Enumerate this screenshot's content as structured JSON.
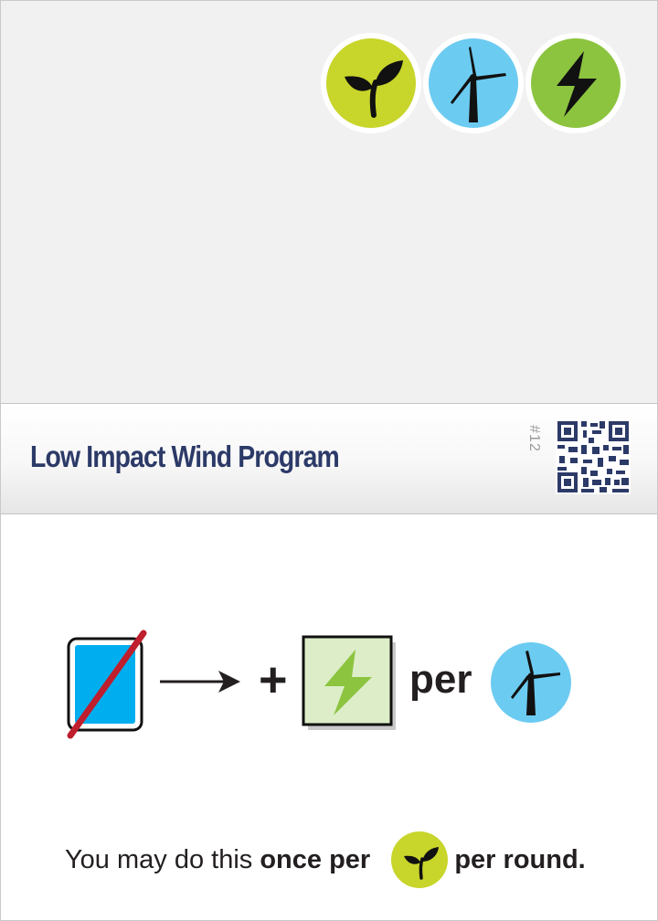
{
  "card": {
    "title": "Low Impact Wind Program",
    "number": "#12",
    "tags": [
      "sprout-icon",
      "wind-turbine-icon",
      "lightning-icon"
    ]
  },
  "effect": {
    "plus": "+",
    "per": "per",
    "cost_icon": "discard-card-icon",
    "gain_icon": "energy-resource-icon",
    "scale_icon": "wind-turbine-icon"
  },
  "note": {
    "prefix": "You may do this ",
    "bold1": "once per",
    "bold2": "per round.",
    "icon": "sprout-icon"
  },
  "colors": {
    "title": "#2c3a68",
    "sprout_bg": "#c8d52a",
    "wind_bg": "#6ccbf1",
    "energy_bg": "#8cc43f",
    "card_blue": "#00aeef",
    "strike": "#be1e2d",
    "energy_tile": "#dcedc8"
  }
}
